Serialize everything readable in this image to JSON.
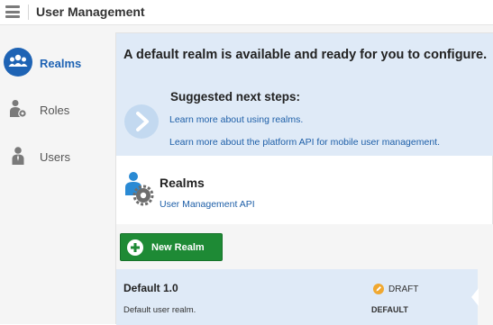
{
  "header": {
    "title": "User Management",
    "menu_icon": "hamburger-menu-icon"
  },
  "sidebar": {
    "items": [
      {
        "label": "Realms",
        "icon": "realms-people-icon",
        "active": true
      },
      {
        "label": "Roles",
        "icon": "roles-user-gear-icon",
        "active": false
      },
      {
        "label": "Users",
        "icon": "user-icon",
        "active": false
      }
    ]
  },
  "banner": {
    "title": "A default realm is available and ready for you to configure.",
    "next_steps_title": "Suggested next steps:",
    "links": [
      "Learn more about using realms.",
      "Learn more about the platform API for mobile user management."
    ],
    "icon": "chevron-right-circle-icon"
  },
  "realms_section": {
    "heading": "Realms",
    "subtitle_link": "User Management API",
    "icon": "realm-user-gear-icon",
    "new_button_label": "New Realm",
    "new_button_icon": "plus-circle-icon"
  },
  "realm_list": [
    {
      "name": "Default 1.0",
      "description": "Default user realm.",
      "status": "DRAFT",
      "status_icon": "pencil-draft-icon",
      "tag": "DEFAULT"
    }
  ],
  "colors": {
    "accent_blue": "#1e63b4",
    "banner_bg": "#dfeaf7",
    "button_green": "#1e8a35",
    "sidebar_bg": "#f5f5f5"
  }
}
